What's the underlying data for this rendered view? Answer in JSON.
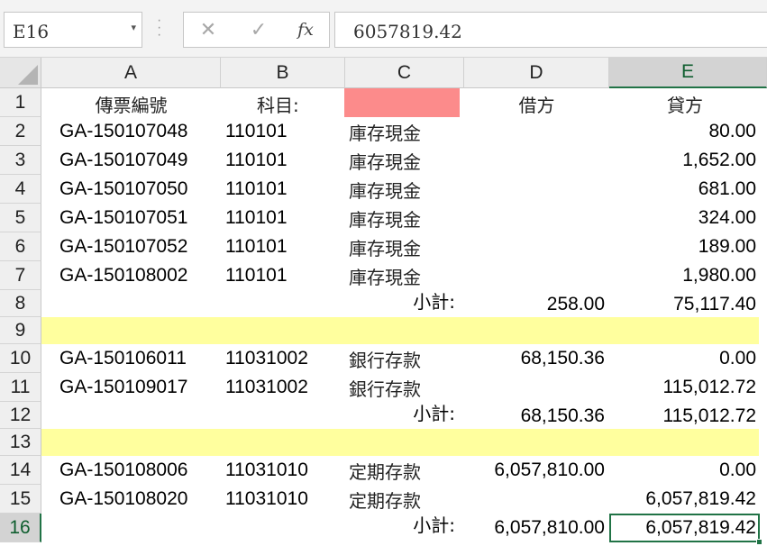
{
  "name_box": {
    "value": "E16"
  },
  "formula_bar": {
    "fx_label": "fx",
    "content": "6057819.42"
  },
  "columns": [
    "A",
    "B",
    "C",
    "D",
    "E"
  ],
  "selected_column": "E",
  "selected_row": "16",
  "rows": [
    {
      "num": "1",
      "type": "header",
      "a": "傳票編號",
      "b": "科目:",
      "c": "",
      "d": "借方",
      "e": "貸方"
    },
    {
      "num": "2",
      "type": "data",
      "a": "GA-150107048",
      "b": "110101",
      "c": "庫存現金",
      "d": "",
      "e": "80.00"
    },
    {
      "num": "3",
      "type": "data",
      "a": "GA-150107049",
      "b": "110101",
      "c": "庫存現金",
      "d": "",
      "e": "1,652.00"
    },
    {
      "num": "4",
      "type": "data",
      "a": "GA-150107050",
      "b": "110101",
      "c": "庫存現金",
      "d": "",
      "e": "681.00"
    },
    {
      "num": "5",
      "type": "data",
      "a": "GA-150107051",
      "b": "110101",
      "c": "庫存現金",
      "d": "",
      "e": "324.00"
    },
    {
      "num": "6",
      "type": "data",
      "a": "GA-150107052",
      "b": "110101",
      "c": "庫存現金",
      "d": "",
      "e": "189.00"
    },
    {
      "num": "7",
      "type": "data",
      "a": "GA-150108002",
      "b": "110101",
      "c": "庫存現金",
      "d": "",
      "e": "1,980.00"
    },
    {
      "num": "8",
      "type": "subtotal",
      "a": "",
      "b": "",
      "c": "小計:",
      "d": "258.00",
      "e": "75,117.40"
    },
    {
      "num": "9",
      "type": "highlight",
      "a": "",
      "b": "",
      "c": "",
      "d": "",
      "e": ""
    },
    {
      "num": "10",
      "type": "data",
      "a": "GA-150106011",
      "b": "11031002",
      "c": "銀行存款",
      "d": "68,150.36",
      "e": "0.00"
    },
    {
      "num": "11",
      "type": "data",
      "a": "GA-150109017",
      "b": "11031002",
      "c": "銀行存款",
      "d": "",
      "e": "115,012.72"
    },
    {
      "num": "12",
      "type": "subtotal",
      "a": "",
      "b": "",
      "c": "小計:",
      "d": "68,150.36",
      "e": "115,012.72"
    },
    {
      "num": "13",
      "type": "highlight",
      "a": "",
      "b": "",
      "c": "",
      "d": "",
      "e": ""
    },
    {
      "num": "14",
      "type": "data",
      "a": "GA-150108006",
      "b": "11031010",
      "c": "定期存款",
      "d": "6,057,810.00",
      "e": "0.00"
    },
    {
      "num": "15",
      "type": "data",
      "a": "GA-150108020",
      "b": "11031010",
      "c": "定期存款",
      "d": "",
      "e": "6,057,819.42"
    },
    {
      "num": "16",
      "type": "subtotal",
      "a": "",
      "b": "",
      "c": "小計:",
      "d": "6,057,810.00",
      "e": "6,057,819.42"
    }
  ],
  "colors": {
    "header_fill_c1": "#fc8b8b",
    "separator_row_fill": "#ffff9e",
    "selection_accent": "#217346"
  }
}
